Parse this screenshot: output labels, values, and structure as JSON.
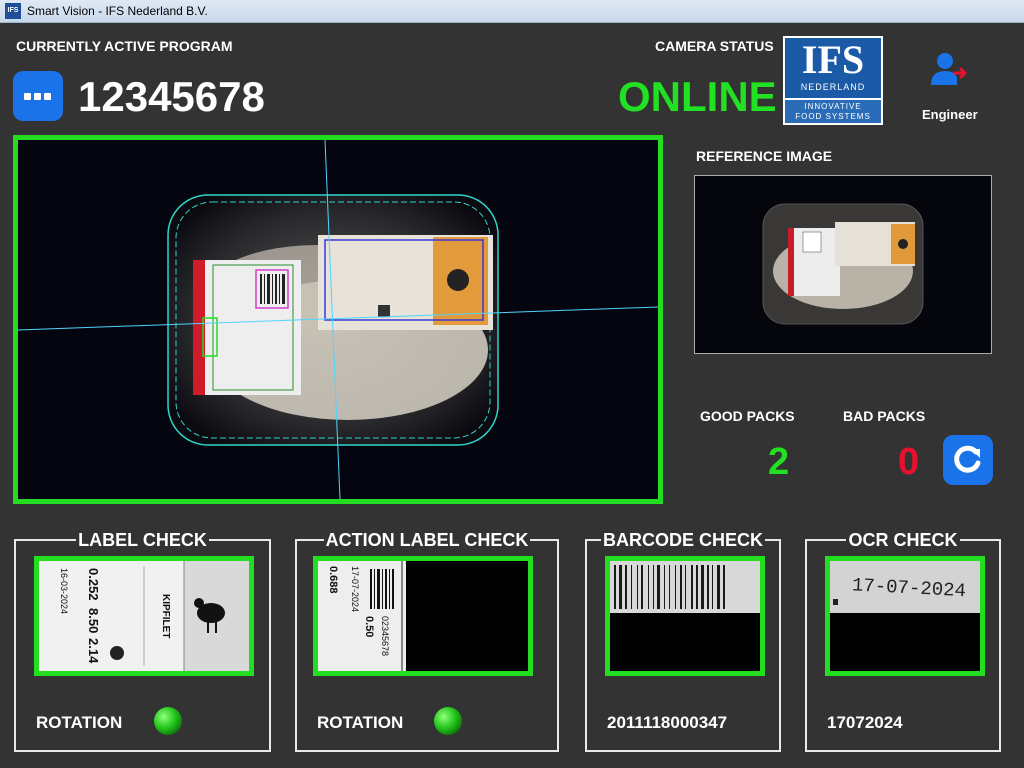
{
  "window": {
    "title": "Smart Vision - IFS Nederland B.V.",
    "icon_text": "IFS"
  },
  "header": {
    "program_label": "CURRENTLY ACTIVE PROGRAM",
    "program_number": "12345678",
    "camera_status_label": "CAMERA STATUS",
    "camera_status": "ONLINE",
    "user_role": "Engineer"
  },
  "logo": {
    "brand": "IFS",
    "country": "NEDERLAND",
    "tagline_1": "INNOVATIVE",
    "tagline_2": "FOOD SYSTEMS"
  },
  "reference": {
    "label": "REFERENCE IMAGE"
  },
  "counters": {
    "good_label": "GOOD PACKS",
    "good_value": "2",
    "bad_label": "BAD PACKS",
    "bad_value": "0"
  },
  "checks": {
    "label": {
      "title": "LABEL CHECK",
      "result_label": "ROTATION"
    },
    "action": {
      "title": "ACTION LABEL CHECK",
      "result_label": "ROTATION"
    },
    "barcode": {
      "title": "BARCODE CHECK",
      "value": "2011118000347"
    },
    "ocr": {
      "title": "OCR CHECK",
      "value": "17072024",
      "image_text": "17-07-2024"
    }
  },
  "label_text": {
    "product": "KIPFILET",
    "weight": "0.252",
    "price_per_kg": "8.50",
    "price": "2.14",
    "date": "16-03-2024",
    "action_weight": "0.688",
    "action_discount": "0.50",
    "action_date": "17-07-2024",
    "action_code": "02345678"
  },
  "colors": {
    "status_online": "#22e022",
    "good": "#22e022",
    "bad": "#e8102f",
    "frame_green": "#22dd22",
    "button_blue": "#1a73e8"
  },
  "icons": {
    "menu": "more-dots-icon",
    "user": "user-logout-icon",
    "reset": "refresh-icon",
    "led": "status-led-icon"
  }
}
